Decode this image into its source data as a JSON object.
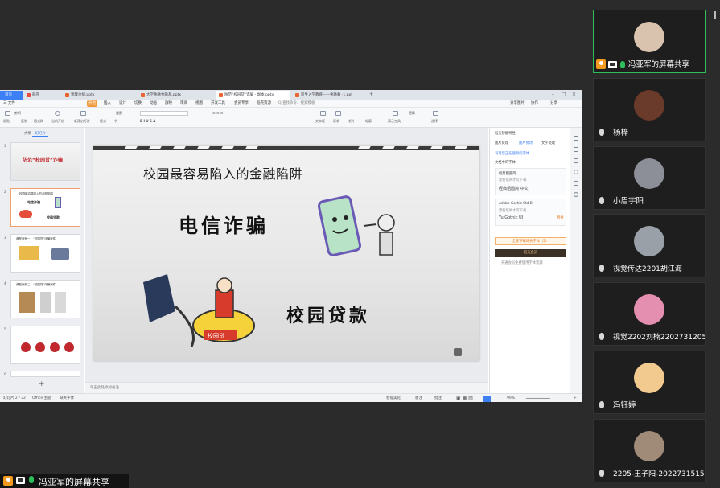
{
  "shared_screen": {
    "tabs": [
      {
        "label": "首页"
      },
      {
        "label": "稻壳"
      },
      {
        "label": "我我介绍.pptx"
      },
      {
        "label": "大学金融金融基.pptx"
      },
      {
        "label": "防范“校园贷”诈骗 - 副本.pptx"
      },
      {
        "label": "新生入学教育——金融教 ·1.ppt"
      }
    ],
    "menu": [
      "三 文件",
      "开始",
      "插入",
      "设计",
      "切换",
      "动画",
      "放映",
      "审阅",
      "视图",
      "开发工具",
      "会员专享",
      "稻壳资源",
      "Q 查找命令、搜索模板"
    ],
    "menu_right": [
      "分享图片",
      "协作",
      "分享"
    ],
    "ribbon": {
      "paste": "粘贴",
      "cut": "剪切",
      "copy": "复制",
      "format_painter": "格式刷",
      "from_current": "当前开始",
      "new_slide": "新建幻灯片",
      "layout": "版式",
      "section": "节",
      "reset": "重置",
      "text_box": "文本框",
      "shape": "形状",
      "arrange": "排列",
      "outline": "轮廓",
      "presentation_tools": "演示工具",
      "replace": "替换",
      "select": "选择"
    },
    "thumb_tabs": [
      "大纲",
      "幻灯片"
    ],
    "thumbnails": [
      {
        "num": "1",
        "title": "防范“校园贷”诈骗"
      },
      {
        "num": "2",
        "title": "校园最容易陷入的金融陷阱",
        "sub1": "电信诈骗",
        "sub2": "校园贷款"
      },
      {
        "num": "3",
        "title": "典型案例一：“校园贷”诈骗案件"
      },
      {
        "num": "4",
        "title": "典型案例二：“校园贷”诈骗案件"
      },
      {
        "num": "5",
        "title": ""
      },
      {
        "num": "6",
        "title": ""
      }
    ],
    "slide": {
      "title": "校园最容易陷入的金融陷阱",
      "item1": "电信诈骗",
      "item2": "校园贷款",
      "stamp": "校园贷"
    },
    "notes_placeholder": "单击此处添加备注",
    "right_panel": {
      "header": "稻壳智能特性",
      "tabs": [
        "图片处理",
        "图片修改",
        "文字处理"
      ],
      "link": "发现您正在使用的字体",
      "subtitle": "文档中的字体",
      "font1_name": "经典粗圆简",
      "font1_status": "需要联网才可下载",
      "font1_sample": "经典粗圆简 中文",
      "font2_name": "Adobe Gothic Std B",
      "font2_status": "需要联网才可下载",
      "font2_sample": "Yu Gothic UI",
      "font2_action": "替换",
      "btn_outline": "全部下载缺失字体（2）",
      "btn_dark": "稻壳会员",
      "hint": "开通会员免费使用字体资源"
    },
    "status": {
      "slide_count": "幻灯片 2 / 32",
      "theme": "Office 主题",
      "missing_font": "缺失字体",
      "smart_beautify": "智能美化",
      "notes": "备注",
      "comments": "批注",
      "zoom": "99%"
    }
  },
  "sharer_label": "冯亚军的屏幕共享",
  "participants": [
    {
      "name": "冯亚军的屏幕共享",
      "avatar_color": "#d9c3ae",
      "sharing": true
    },
    {
      "name": "杨梓",
      "avatar_color": "#6a3a2a"
    },
    {
      "name": "小眉宇阳",
      "avatar_color": "#8d8f98"
    },
    {
      "name": "视觉传达2201胡江海",
      "avatar_color": "#9aa0a8"
    },
    {
      "name": "视觉2202刘楠2202731205",
      "avatar_color": "#e58fb0"
    },
    {
      "name": "冯钰婷",
      "avatar_color": "#f2c98f"
    },
    {
      "name": "2205-王子阳-2022731515",
      "avatar_color": "#a08b78"
    }
  ],
  "colors": {
    "accent_green": "#2fbf5a",
    "accent_orange": "#f39a1e",
    "wps_blue": "#3d7ff5",
    "background": "#2b2b2b"
  },
  "icons": [
    "person-icon",
    "screen-share-icon",
    "mic-icon",
    "mic-muted-icon"
  ]
}
